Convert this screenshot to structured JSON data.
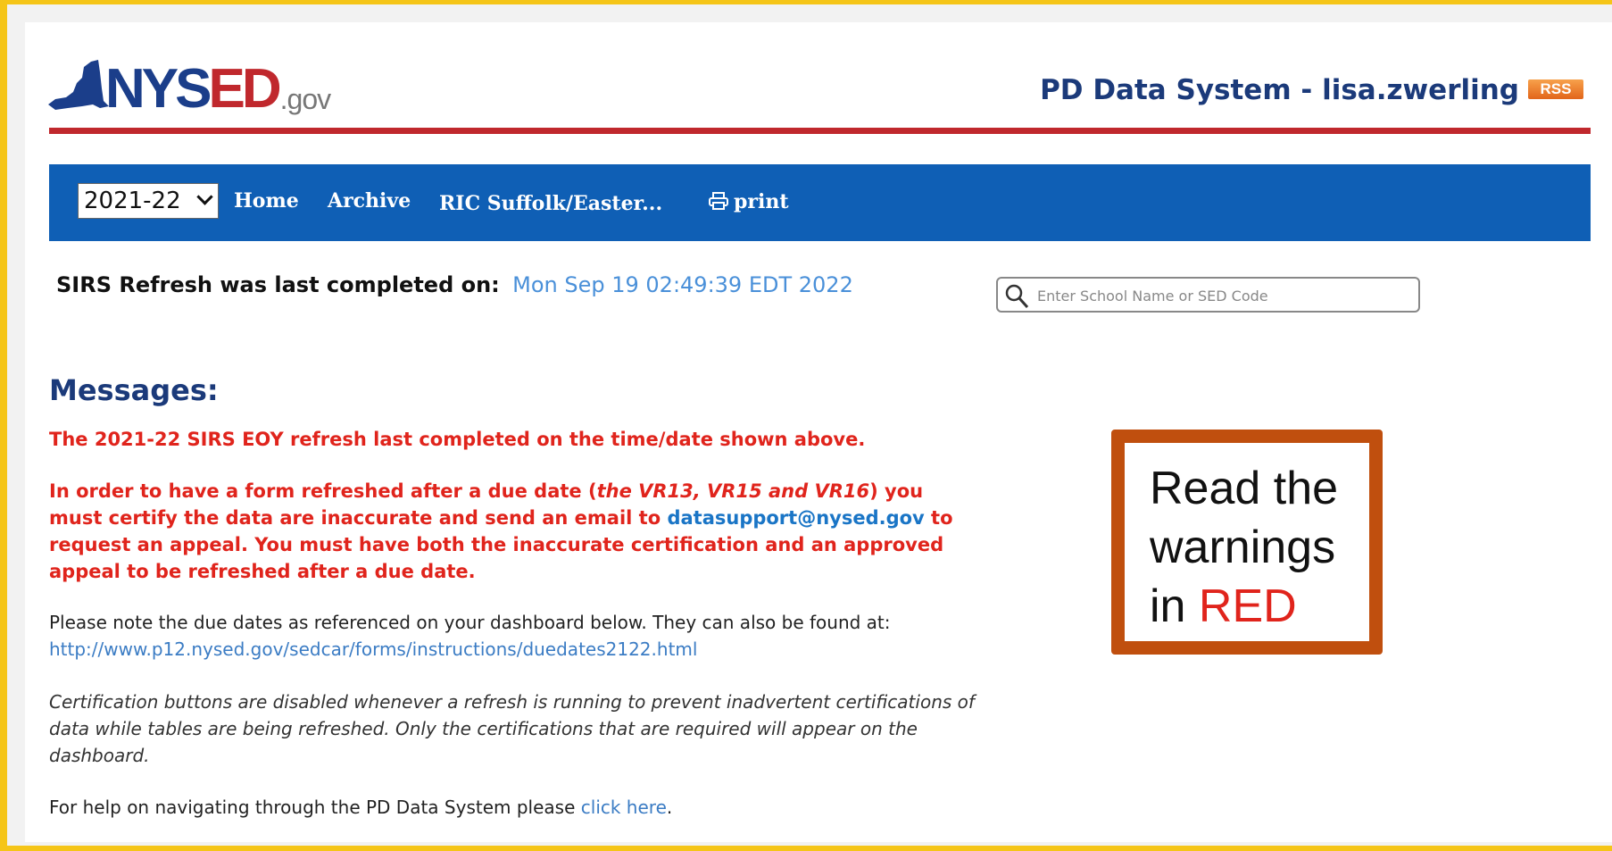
{
  "header": {
    "logo_main": "NYS",
    "logo_ed": "ED",
    "logo_gov": ".gov",
    "app_title": "PD Data System - lisa.zwerling",
    "rss_badge": "RSS"
  },
  "nav": {
    "year_selected": "2021-22",
    "home": "Home",
    "archive": "Archive",
    "ric": "RIC Suffolk/Easter...",
    "print": "print"
  },
  "refresh": {
    "label": "SIRS Refresh was last completed on:",
    "date": "Mon Sep 19 02:49:39 EDT 2022"
  },
  "search": {
    "placeholder": "Enter School Name or SED Code"
  },
  "messages": {
    "title": "Messages:",
    "p1": "The 2021-22 SIRS EOY refresh last completed on the time/date shown above.",
    "p2_a": "In order to have a form refreshed after a due date (",
    "p2_em": "the VR13, VR15 and VR16",
    "p2_b": ") you must certify the data are inaccurate and send an email to ",
    "p2_email": "datasupport@nysed.gov",
    "p2_c": " to request an appeal. You must have both the inaccurate certification and an approved appeal to be refreshed after a due date.",
    "p3_text": "Please note the due dates as referenced on your dashboard below. They can also be found at:",
    "p3_link": "http://www.p12.nysed.gov/sedcar/forms/instructions/duedates2122.html",
    "p4": "Certification buttons are disabled whenever a refresh is running to prevent inadvertent certifications of data while tables are being refreshed. Only the certifications that are required will appear on the dashboard.",
    "p5_text": "For help on navigating through the PD Data System please ",
    "p5_link": "click here",
    "p5_end": "."
  },
  "callout": {
    "line1": "Read the",
    "line2": "warnings",
    "line3_a": "in ",
    "line3_red": "RED"
  },
  "colors": {
    "border": "#f5c518",
    "nav_bg": "#0f5fb5",
    "red_rule": "#c0282d",
    "warning_red": "#e0241c",
    "callout_border": "#c04f0e"
  }
}
